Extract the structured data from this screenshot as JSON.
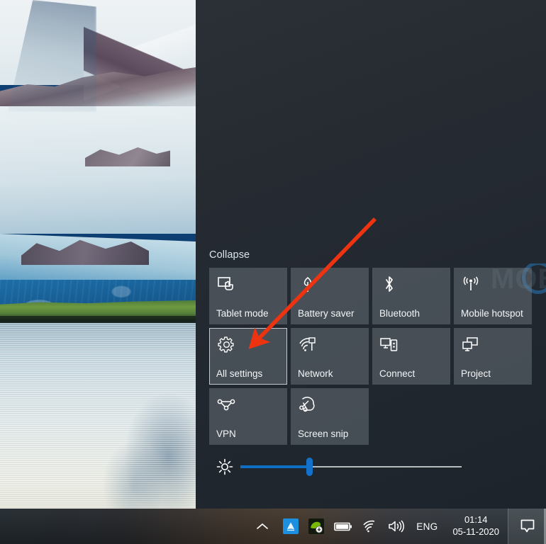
{
  "desktop": {
    "wallpaper_description": "glacier-mountain-lake-photo"
  },
  "action_center": {
    "collapse_label": "Collapse",
    "tiles": [
      {
        "label": "Tablet mode",
        "icon": "tablet-mode-icon",
        "state": "normal"
      },
      {
        "label": "Battery saver",
        "icon": "battery-saver-icon",
        "state": "normal"
      },
      {
        "label": "Bluetooth",
        "icon": "bluetooth-icon",
        "state": "normal"
      },
      {
        "label": "Mobile hotspot",
        "icon": "mobile-hotspot-icon",
        "state": "normal"
      },
      {
        "label": "All settings",
        "icon": "gear-icon",
        "state": "hover"
      },
      {
        "label": "Network",
        "icon": "network-icon",
        "state": "normal"
      },
      {
        "label": "Connect",
        "icon": "connect-icon",
        "state": "normal"
      },
      {
        "label": "Project",
        "icon": "project-icon",
        "state": "normal"
      },
      {
        "label": "VPN",
        "icon": "vpn-icon",
        "state": "normal"
      },
      {
        "label": "Screen snip",
        "icon": "screen-snip-icon",
        "state": "normal"
      }
    ],
    "brightness": {
      "icon": "brightness-icon",
      "value_percent": 31
    }
  },
  "annotation": {
    "type": "red-arrow",
    "points_to": "All settings",
    "color": "#ee3311"
  },
  "watermark": {
    "text": "MOBIGYAAN"
  },
  "taskbar": {
    "tray": {
      "show_hidden_icons": "show-hidden-icons-chevron",
      "icons": [
        {
          "name": "blue-app-icon"
        },
        {
          "name": "nvidia-update-icon"
        },
        {
          "name": "battery-icon"
        },
        {
          "name": "wifi-icon"
        },
        {
          "name": "volume-icon"
        }
      ],
      "language": "ENG",
      "time": "01:14",
      "date": "05-11-2020",
      "action_center_icon": "action-center-icon"
    }
  },
  "colors": {
    "panel_bg": "#262b32",
    "tile_bg": "#7d858c",
    "accent": "#0f6fc5",
    "annotation_red": "#ee3311",
    "text": "#f3f6f8"
  }
}
